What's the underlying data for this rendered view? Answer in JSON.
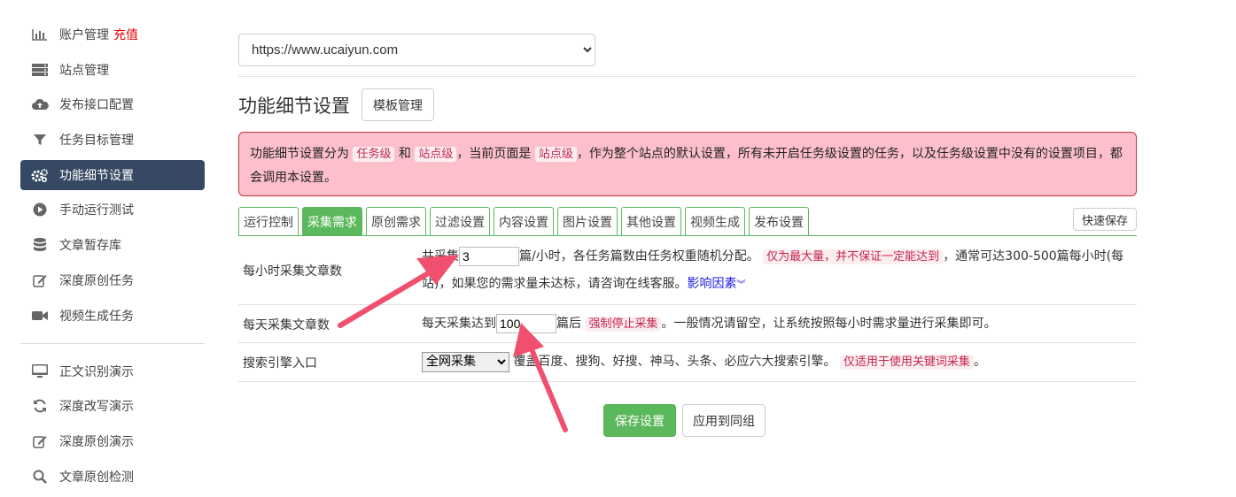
{
  "sidebar": {
    "items": [
      {
        "label": "账户管理",
        "extra": "充值",
        "icon": "bar-chart-icon"
      },
      {
        "label": "站点管理",
        "icon": "server-icon"
      },
      {
        "label": "发布接口配置",
        "icon": "cloud-upload-icon"
      },
      {
        "label": "任务目标管理",
        "icon": "filter-icon"
      },
      {
        "label": "功能细节设置",
        "icon": "gears-icon",
        "active": true
      },
      {
        "label": "手动运行测试",
        "icon": "play-circle-icon"
      },
      {
        "label": "文章暂存库",
        "icon": "database-icon"
      },
      {
        "label": "深度原创任务",
        "icon": "edit-icon"
      },
      {
        "label": "视频生成任务",
        "icon": "video-camera-icon"
      }
    ],
    "demo_items": [
      {
        "label": "正文识别演示",
        "icon": "monitor-icon"
      },
      {
        "label": "深度改写演示",
        "icon": "refresh-icon"
      },
      {
        "label": "深度原创演示",
        "icon": "edit-icon"
      },
      {
        "label": "文章原创检测",
        "icon": "search-icon"
      }
    ]
  },
  "site_select": {
    "value": "https://www.ucaiyun.com"
  },
  "heading": "功能细节设置",
  "template_button": "模板管理",
  "alert": {
    "p1": "功能细节设置分为",
    "c1": "任务级",
    "p2": "和",
    "c2": "站点级",
    "p3": "，当前页面是",
    "c3": "站点级",
    "p4": "，作为整个站点的默认设置，所有未开启任务级设置的任务，以及任务级设置中没有的设置项目，都会调用本设置。"
  },
  "tabs": [
    "运行控制",
    "采集需求",
    "原创需求",
    "过滤设置",
    "内容设置",
    "图片设置",
    "其他设置",
    "视频生成",
    "发布设置"
  ],
  "active_tab": "采集需求",
  "quick_save": "快速保存",
  "rows": {
    "hourly": {
      "label": "每小时采集文章数",
      "t1": "共采集",
      "value": "3",
      "t2": "篇/小时，各任务篇数由任务权重随机分配。",
      "code": "仅为最大量，并不保证一定能达到",
      "t3": "，通常可达300-500篇每小时(每站)，如果您的需求量未达标，请咨询在线客服。",
      "link": "影响因素"
    },
    "daily": {
      "label": "每天采集文章数",
      "t1": "每天采集达到",
      "value": "100",
      "t2": "篇后",
      "code": "强制停止采集",
      "t3": "。一般情况请留空，让系统按照每小时需求量进行采集即可。"
    },
    "engine": {
      "label": "搜索引擎入口",
      "select": "全网采集",
      "t1": "覆盖百度、搜狗、好搜、神马、头条、必应六大搜索引擎。",
      "code": "仅适用于使用关键词采集",
      "t2": "。"
    }
  },
  "save_button": "保存设置",
  "apply_button": "应用到同组",
  "colors": {
    "accent_green": "#5cb85c",
    "sidebar_active": "#364863",
    "alert_bg": "#fdc0cb",
    "arrow": "#f0506e"
  }
}
